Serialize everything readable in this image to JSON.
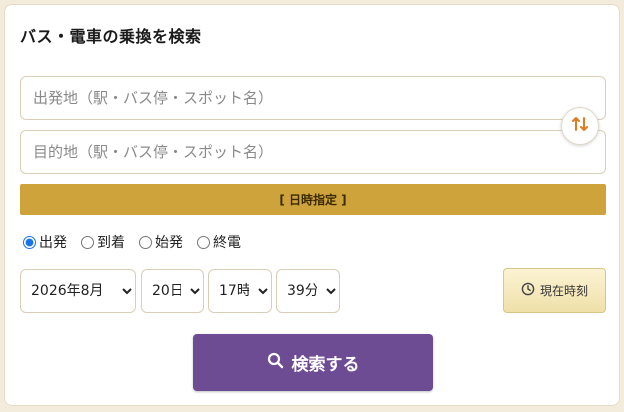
{
  "title": "バス・電車の乗換を検索",
  "from": {
    "placeholder": "出発地（駅・バス停・スポット名）"
  },
  "to": {
    "placeholder": "目的地（駅・バス停・スポット名）"
  },
  "swap_icon": "swap-vertical-icon",
  "datetime_bar": "[ 日時指定 ]",
  "modes": [
    {
      "label": "出発",
      "checked": true
    },
    {
      "label": "到着",
      "checked": false
    },
    {
      "label": "始発",
      "checked": false
    },
    {
      "label": "終電",
      "checked": false
    }
  ],
  "selects": {
    "month": "2026年8月",
    "day": "20日",
    "hour": "17時",
    "minute": "39分"
  },
  "now_button": "現在時刻",
  "search_button": "検索する",
  "colors": {
    "accent_bar": "#cfa33c",
    "search_button": "#6e4c94",
    "swap_icon": "#e07a1a"
  }
}
